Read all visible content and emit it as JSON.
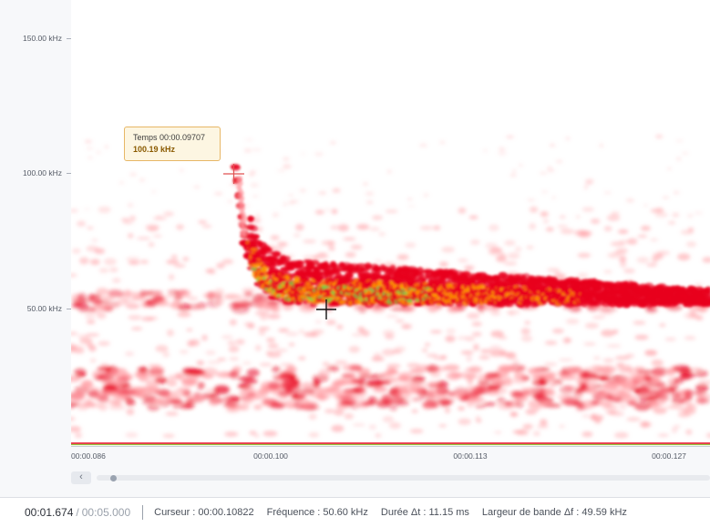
{
  "y_axis": {
    "labels": [
      "150.00 kHz",
      "100.00 kHz",
      "50.00 kHz"
    ]
  },
  "x_axis": {
    "labels": [
      "00:00.086",
      "00:00.100",
      "00:00.113",
      "00:00.127"
    ]
  },
  "tooltip": {
    "time_label": "Temps 00:00.09707",
    "freq_label": "100.19 kHz"
  },
  "status": {
    "current_time": "00:01.674",
    "separator": "/",
    "total_time": "00:05.000",
    "cursor": "Curseur : 00:00.10822",
    "frequency": "Fréquence : 50.60 kHz",
    "duration": "Durée Δt : 11.15 ms",
    "bandwidth": "Largeur de bande Δf : 49.59 kHz"
  },
  "scrollbar": {
    "left_arrow": "‹"
  },
  "colors": {
    "low": "#ff9aa0",
    "mid": "#e8001c",
    "high": "#ff9a00",
    "peak": "#6fd64a",
    "marker_start": "#e05050",
    "marker_end": "#111111"
  }
}
